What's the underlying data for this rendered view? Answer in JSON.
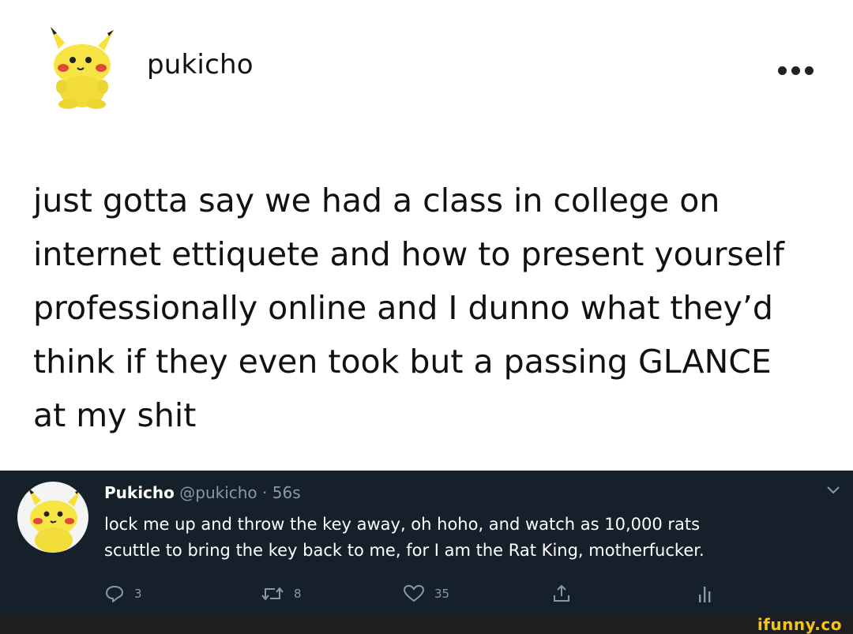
{
  "tumblr_post": {
    "username": "pukicho",
    "body_lines": [
      "just gotta say we had a class in college on",
      "internet ettiquete and how to present yourself",
      "professionally online and I dunno what they’d",
      "think if they even took but a passing GLANCE",
      "at my shit"
    ],
    "avatar_icon": "pikachu-plush-avatar",
    "more_icon": "more-options-icon"
  },
  "tweet": {
    "display_name": "Pukicho",
    "handle_time": "@pukicho · 56s",
    "text_lines": [
      "lock me up and throw the key away, oh hoho, and watch as 10,000 rats",
      "scuttle to bring the key back to me, for I am the Rat King, motherfucker."
    ],
    "actions": {
      "reply_count": "3",
      "retweet_count": "8",
      "like_count": "35"
    },
    "background": "#15202b",
    "text_color": "#ffffff",
    "muted_color": "#8899a6"
  },
  "watermark": {
    "text": "ifunny.co",
    "color": "#f6c416"
  }
}
